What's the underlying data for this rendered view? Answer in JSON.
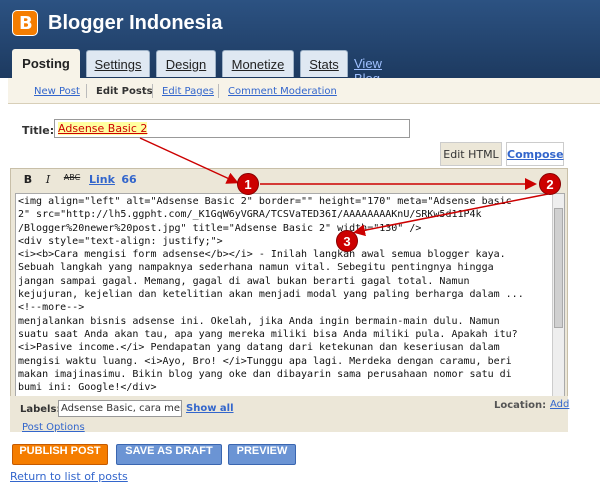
{
  "app": {
    "title": "Blogger Indonesia",
    "logo_letter": "B"
  },
  "tabs": [
    "Posting",
    "Settings",
    "Design",
    "Monetize",
    "Stats"
  ],
  "view_blog": "View Blog",
  "subnav": [
    "New Post",
    "Edit Posts",
    "Edit Pages",
    "Comment Moderation"
  ],
  "post": {
    "title_label": "Title:",
    "title_value": "Adsense Basic 2",
    "mode_tabs": {
      "edit_html": "Edit HTML",
      "compose": "Compose"
    },
    "toolbar": {
      "bold": "B",
      "italic": "I",
      "strike": "ABC",
      "link": "Link",
      "quote": "66"
    },
    "html_lines": [
      "<img align=\"left\" alt=\"Adsense Basic 2\" border=\"\" height=\"170\" meta=\"Adsense basic",
      "2\" src=\"http://lh5.ggpht.com/_K1GqW6yVGRA/TCSVaTED36I/AAAAAAAAKnU/SRKw5d11P4k",
      "/Blogger%20newer%20post.jpg\" title=\"Adsense Basic 2\" width=\"130\" />",
      "<div style=\"text-align: justify;\">",
      "<i><b>Cara mengisi form adsense</b></i> - Inilah langkah awal semua blogger kaya.",
      "Sebuah langkah yang nampaknya sederhana namun vital. Sebegitu pentingnya hingga",
      "jangan sampai gagal. Memang, gagal di awal bukan berarti gagal total. Namun",
      "kejujuran, kejelian dan ketelitian akan menjadi modal yang paling berharga dalam ...",
      "<!--more-->",
      "menjalankan bisnis adsense ini. Okelah, jika Anda ingin bermain-main dulu. Namun",
      "suatu saat Anda akan tau, apa yang mereka miliki bisa Anda miliki pula. Apakah itu?",
      "<i>Pasive income.</i> Pendapatan yang datang dari ketekunan dan keseriusan dalam",
      "mengisi waktu luang. <i>Ayo, Bro! </i>Tunggu apa lagi. Merdeka dengan caramu, beri",
      "makan imajinasimu. Bikin blog yang oke dan dibayarin sama perusahaan nomor satu di",
      "bumi ini: Google!</div>"
    ],
    "labels_label": "Labels:",
    "labels_value": "Adsense Basic, cara men",
    "show_all": "Show all",
    "location_label": "Location:",
    "add_label": "Add",
    "post_options": "Post Options"
  },
  "buttons": {
    "publish": "PUBLISH POST",
    "draft": "SAVE AS DRAFT",
    "preview": "PREVIEW"
  },
  "return_link": "Return to list of posts",
  "annotations": [
    "1",
    "2",
    "3"
  ],
  "colors": {
    "header": "#2c5282",
    "publish": "#f57d00",
    "secondary_button": "#6b94d4",
    "marker": "#cc0000",
    "highlight": "#ffffa0"
  }
}
